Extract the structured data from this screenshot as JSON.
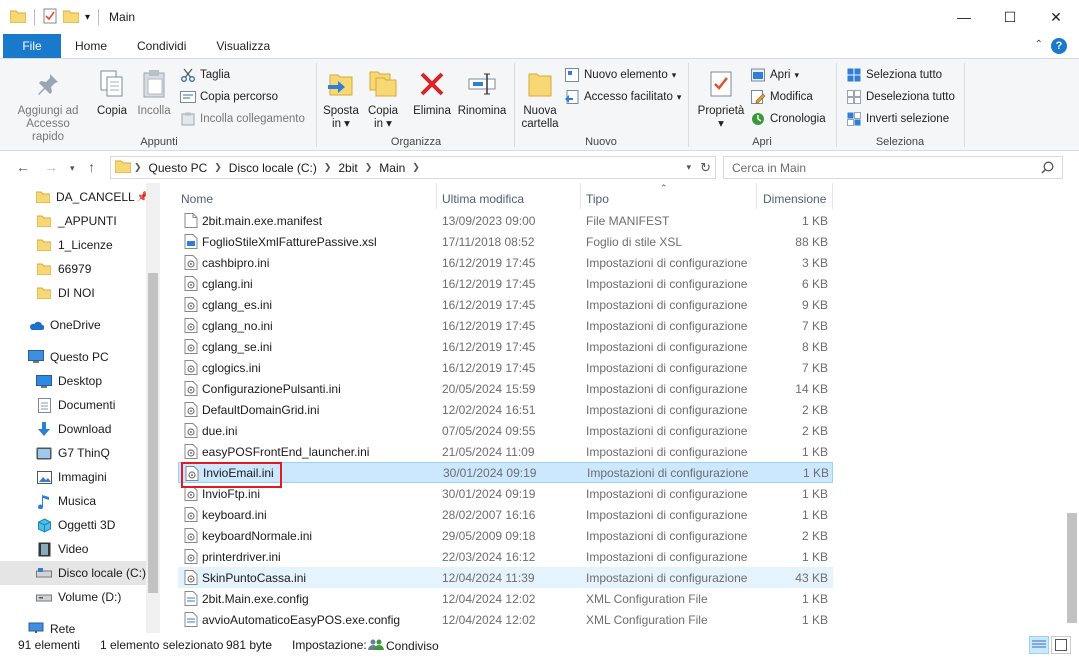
{
  "window": {
    "title": "Main"
  },
  "tabs": [
    {
      "label": "File"
    },
    {
      "label": "Home"
    },
    {
      "label": "Condividi"
    },
    {
      "label": "Visualizza"
    }
  ],
  "ribbon": {
    "appunti": {
      "label": "Appunti",
      "pin_line1": "Aggiungi ad",
      "pin_line2": "Accesso rapido",
      "copia": "Copia",
      "incolla": "Incolla",
      "taglia": "Taglia",
      "copia_percorso": "Copia percorso",
      "incolla_collegamento": "Incolla collegamento"
    },
    "organizza": {
      "label": "Organizza",
      "sposta_line1": "Sposta",
      "sposta_line2": "in",
      "copia_line1": "Copia",
      "copia_line2": "in",
      "elimina": "Elimina",
      "rinomina": "Rinomina"
    },
    "nuovo": {
      "label": "Nuovo",
      "nuova_line1": "Nuova",
      "nuova_line2": "cartella",
      "nuovo_elemento": "Nuovo elemento",
      "accesso_facilitato": "Accesso facilitato"
    },
    "apri": {
      "label": "Apri",
      "proprieta": "Proprietà",
      "apri": "Apri",
      "modifica": "Modifica",
      "cronologia": "Cronologia"
    },
    "seleziona": {
      "label": "Seleziona",
      "tutto": "Seleziona tutto",
      "deseleziona": "Deseleziona tutto",
      "inverti": "Inverti selezione"
    }
  },
  "address": {
    "crumbs": [
      "Questo PC",
      "Disco locale (C:)",
      "2bit",
      "Main"
    ],
    "search_placeholder": "Cerca in Main"
  },
  "nav": {
    "items": [
      {
        "label": "DA_CANCELL",
        "icon": "folder-icon"
      },
      {
        "label": "_APPUNTI",
        "icon": "folder-icon"
      },
      {
        "label": "1_Licenze",
        "icon": "folder-icon"
      },
      {
        "label": "66979",
        "icon": "folder-icon"
      },
      {
        "label": "DI NOI",
        "icon": "folder-icon"
      },
      {
        "label": "OneDrive",
        "icon": "cloud-icon"
      },
      {
        "label": "Questo PC",
        "icon": "computer-icon"
      },
      {
        "label": "Desktop",
        "icon": "desktop-icon"
      },
      {
        "label": "Documenti",
        "icon": "documents-icon"
      },
      {
        "label": "Download",
        "icon": "download-icon"
      },
      {
        "label": "G7 ThinQ",
        "icon": "phone-icon"
      },
      {
        "label": "Immagini",
        "icon": "pictures-icon"
      },
      {
        "label": "Musica",
        "icon": "music-icon"
      },
      {
        "label": "Oggetti 3D",
        "icon": "cube-icon"
      },
      {
        "label": "Video",
        "icon": "video-icon"
      },
      {
        "label": "Disco locale (C:)",
        "icon": "drive-icon"
      },
      {
        "label": "Volume (D:)",
        "icon": "drive-icon"
      },
      {
        "label": "Rete",
        "icon": "network-icon"
      }
    ]
  },
  "columns": {
    "name": "Nome",
    "date": "Ultima modifica",
    "type": "Tipo",
    "size": "Dimensione"
  },
  "files": [
    {
      "name": "2bit.main.exe.manifest",
      "date": "13/09/2023 09:00",
      "type": "File MANIFEST",
      "size": "1 KB",
      "icon": "file"
    },
    {
      "name": "FoglioStileXmlFatturePassive.xsl",
      "date": "17/11/2018 08:52",
      "type": "Foglio di stile XSL",
      "size": "88 KB",
      "icon": "xsl"
    },
    {
      "name": "cashbipro.ini",
      "date": "16/12/2019 17:45",
      "type": "Impostazioni di configurazione",
      "size": "3 KB",
      "icon": "ini"
    },
    {
      "name": "cglang.ini",
      "date": "16/12/2019 17:45",
      "type": "Impostazioni di configurazione",
      "size": "6 KB",
      "icon": "ini"
    },
    {
      "name": "cglang_es.ini",
      "date": "16/12/2019 17:45",
      "type": "Impostazioni di configurazione",
      "size": "9 KB",
      "icon": "ini"
    },
    {
      "name": "cglang_no.ini",
      "date": "16/12/2019 17:45",
      "type": "Impostazioni di configurazione",
      "size": "7 KB",
      "icon": "ini"
    },
    {
      "name": "cglang_se.ini",
      "date": "16/12/2019 17:45",
      "type": "Impostazioni di configurazione",
      "size": "8 KB",
      "icon": "ini"
    },
    {
      "name": "cglogics.ini",
      "date": "16/12/2019 17:45",
      "type": "Impostazioni di configurazione",
      "size": "7 KB",
      "icon": "ini"
    },
    {
      "name": "ConfigurazionePulsanti.ini",
      "date": "20/05/2024 15:59",
      "type": "Impostazioni di configurazione",
      "size": "14 KB",
      "icon": "ini"
    },
    {
      "name": "DefaultDomainGrid.ini",
      "date": "12/02/2024 16:51",
      "type": "Impostazioni di configurazione",
      "size": "2 KB",
      "icon": "ini"
    },
    {
      "name": "due.ini",
      "date": "07/05/2024 09:55",
      "type": "Impostazioni di configurazione",
      "size": "2 KB",
      "icon": "ini"
    },
    {
      "name": "easyPOSFrontEnd_launcher.ini",
      "date": "21/05/2024 11:09",
      "type": "Impostazioni di configurazione",
      "size": "1 KB",
      "icon": "ini"
    },
    {
      "name": "InvioEmail.ini",
      "date": "30/01/2024 09:19",
      "type": "Impostazioni di configurazione",
      "size": "1 KB",
      "icon": "ini",
      "state": "sel"
    },
    {
      "name": "InvioFtp.ini",
      "date": "30/01/2024 09:19",
      "type": "Impostazioni di configurazione",
      "size": "1 KB",
      "icon": "ini"
    },
    {
      "name": "keyboard.ini",
      "date": "28/02/2007 16:16",
      "type": "Impostazioni di configurazione",
      "size": "1 KB",
      "icon": "ini"
    },
    {
      "name": "keyboardNormale.ini",
      "date": "29/05/2009 09:18",
      "type": "Impostazioni di configurazione",
      "size": "2 KB",
      "icon": "ini"
    },
    {
      "name": "printerdriver.ini",
      "date": "22/03/2024 16:12",
      "type": "Impostazioni di configurazione",
      "size": "1 KB",
      "icon": "ini"
    },
    {
      "name": "SkinPuntoCassa.ini",
      "date": "12/04/2024 11:39",
      "type": "Impostazioni di configurazione",
      "size": "43 KB",
      "icon": "ini",
      "state": "hover"
    },
    {
      "name": "2bit.Main.exe.config",
      "date": "12/04/2024 12:02",
      "type": "XML Configuration File",
      "size": "1 KB",
      "icon": "config"
    },
    {
      "name": "avvioAutomaticoEasyPOS.exe.config",
      "date": "12/04/2024 12:02",
      "type": "XML Configuration File",
      "size": "1 KB",
      "icon": "config"
    }
  ],
  "status": {
    "count": "91 elementi",
    "selected": "1 elemento selezionato",
    "size": "981 byte",
    "setting_label": "Impostazione:",
    "setting_value": "Condiviso"
  },
  "colors": {
    "accent": "#1979ca",
    "selection": "#cce8ff",
    "highlight_box": "#e21b22",
    "folder": "#f8d775"
  }
}
